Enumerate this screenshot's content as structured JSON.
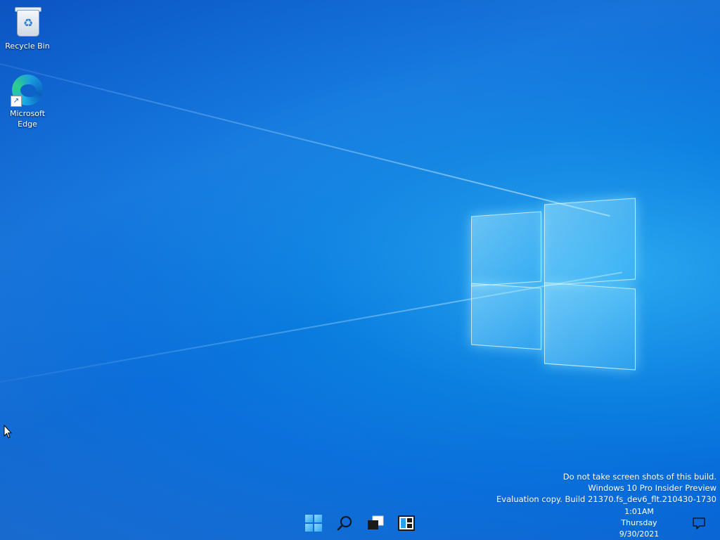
{
  "desktop": {
    "icons": [
      {
        "label": "Recycle Bin",
        "icon": "recycle-bin-icon"
      },
      {
        "label": "Microsoft Edge",
        "icon": "edge-icon"
      }
    ]
  },
  "watermark": {
    "line1": "Do not take screen shots of this build.",
    "line2": "Windows 10 Pro Insider Preview",
    "line3": "Evaluation copy. Build 21370.fs_dev6_flt.210430-1730"
  },
  "taskbar": {
    "buttons": [
      {
        "name": "start",
        "icon": "windows-start-icon"
      },
      {
        "name": "search",
        "icon": "search-icon"
      },
      {
        "name": "task-view",
        "icon": "task-view-icon"
      },
      {
        "name": "widgets",
        "icon": "widgets-icon"
      }
    ],
    "clock": {
      "time": "1:01AM",
      "day": "Thursday",
      "date": "9/30/2021"
    },
    "notification_icon": "notification-icon"
  },
  "colors": {
    "accent": "#0b7fe0",
    "logo_glow": "#aeeaff"
  }
}
